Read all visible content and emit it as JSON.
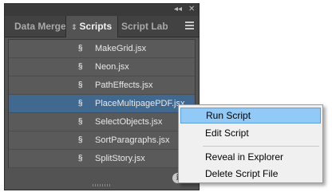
{
  "panel": {
    "controls": {
      "collapse": "◂◂",
      "close": "✕"
    },
    "tabs": [
      {
        "label": "Data Merge"
      },
      {
        "label": "Scripts"
      },
      {
        "label": "Script Label"
      }
    ],
    "scripts": [
      {
        "name": "MakeGrid.jsx"
      },
      {
        "name": "Neon.jsx"
      },
      {
        "name": "PathEffects.jsx"
      },
      {
        "name": "PlaceMultipagePDF.jsx",
        "selected": true
      },
      {
        "name": "SelectObjects.jsx"
      },
      {
        "name": "SortParagraphs.jsx"
      },
      {
        "name": "SplitStory.jsx"
      }
    ],
    "info_glyph": "i"
  },
  "context_menu": {
    "items": [
      {
        "label": "Run Script",
        "highlighted": true
      },
      {
        "label": "Edit Script"
      },
      {
        "label": "Reveal in Explorer"
      },
      {
        "label": "Delete Script File"
      }
    ]
  },
  "colors": {
    "panel_bg": "#535353",
    "selection": "#41698f",
    "menu_highlight": "#91c9f7"
  }
}
